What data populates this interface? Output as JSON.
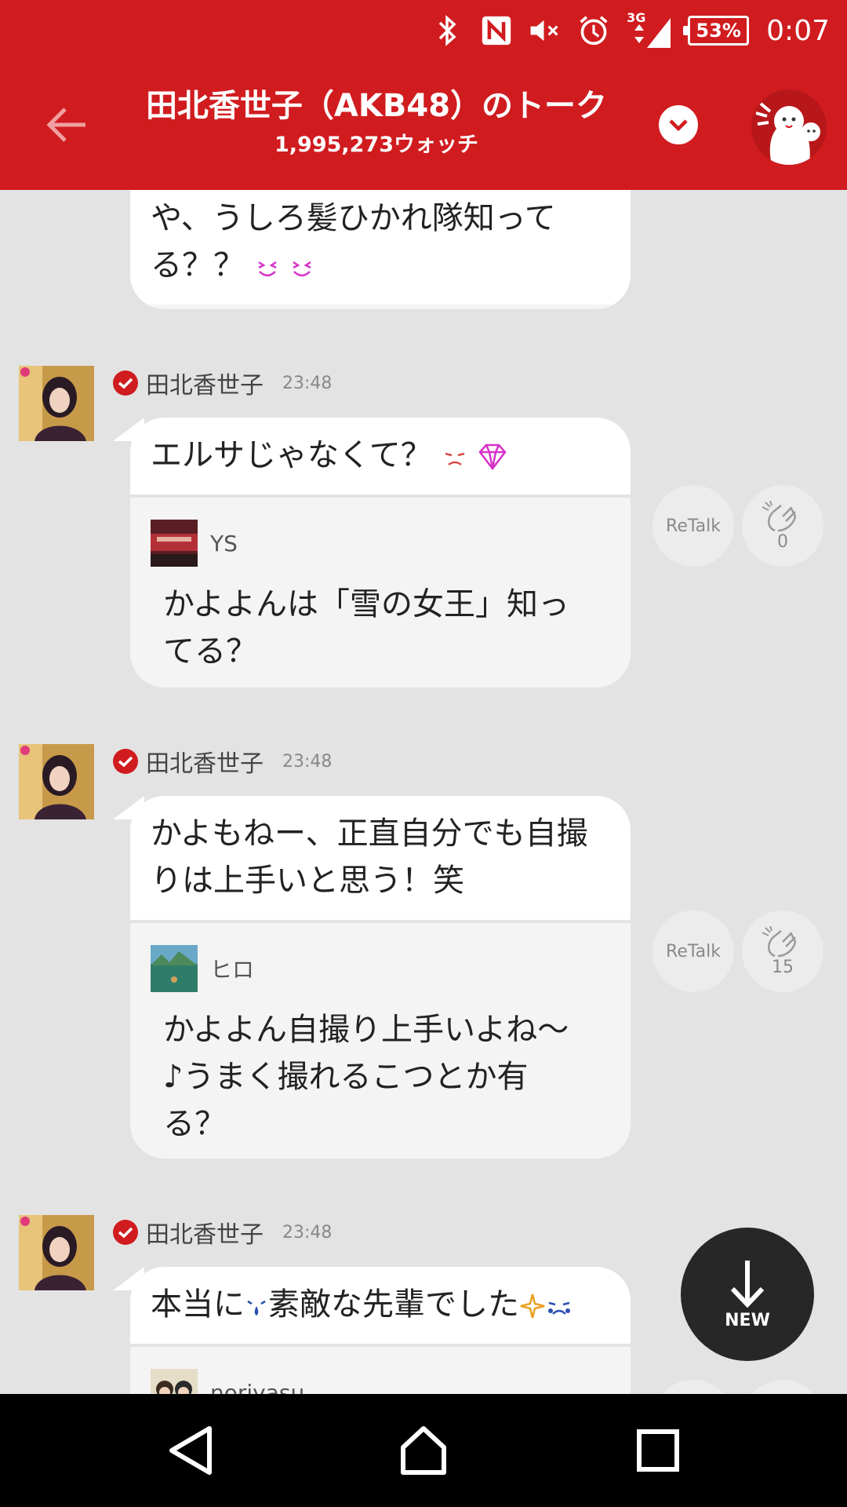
{
  "status_bar": {
    "network": "3G",
    "battery": "53%",
    "time": "0:07"
  },
  "header": {
    "title": "田北香世子（AKB48）のトーク",
    "watch_count": "1,995,273ウォッチ"
  },
  "messages": [
    {
      "text": "や、うしろ髪ひかれ隊知ってる？？",
      "text_lines": [
        "や、うしろ髪ひかれ隊知って",
        "る？？"
      ]
    },
    {
      "poster": "田北香世子",
      "time": "23:48",
      "text": "エルサじゃなくて？",
      "quote_name": "YS",
      "quote_lines": [
        "かよよんは「雪の女王」知っ",
        "てる？"
      ],
      "retalk_label": "ReTalk",
      "clap_count": "0"
    },
    {
      "poster": "田北香世子",
      "time": "23:48",
      "text_lines": [
        "かよもねー、正直自分でも自撮",
        "りは上手いと思う！笑"
      ],
      "quote_name": "ヒロ",
      "quote_lines": [
        "かよよん自撮り上手いよね〜",
        "♪うまく撮れるこつとか有",
        "る？"
      ],
      "retalk_label": "ReTalk",
      "clap_count": "15"
    },
    {
      "poster": "田北香世子",
      "time": "23:48",
      "text_a": "本当に",
      "text_b": "素敵な先輩でした",
      "quote_name": "noriyasu"
    }
  ],
  "new_button": {
    "label": "NEW"
  },
  "colors": {
    "brand_red": "#d01c1f",
    "background": "#e3e3e3",
    "bubble": "#f4f4f4",
    "fab": "#272727"
  },
  "icons": [
    "bluetooth-icon",
    "nfc-icon",
    "mute-icon",
    "alarm-icon",
    "signal-icon",
    "battery-icon",
    "back-arrow-icon",
    "chevron-down-icon",
    "mascot-icon",
    "verified-icon",
    "clap-icon",
    "down-arrow-icon",
    "nav-back-icon",
    "nav-home-icon",
    "nav-recents-icon"
  ]
}
